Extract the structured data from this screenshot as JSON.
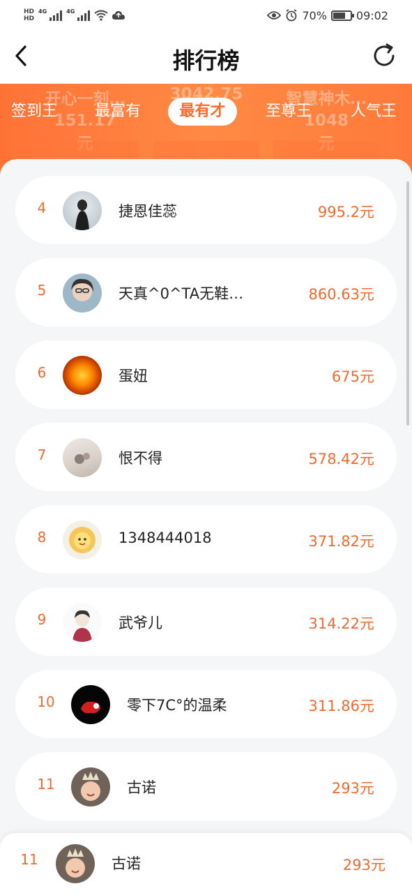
{
  "status": {
    "battery": "70%",
    "time": "09:02",
    "net1": "4G",
    "net2": "4G"
  },
  "nav": {
    "title": "排行榜"
  },
  "tabs": [
    {
      "label": "签到王"
    },
    {
      "label": "最富有"
    },
    {
      "label": "最有才"
    },
    {
      "label": "至尊王"
    },
    {
      "label": "人气王"
    }
  ],
  "podium": [
    {
      "name": "开心一刻…",
      "amount": "151.17",
      "unit": "元"
    },
    {
      "name": "",
      "amount": "3042.75",
      "unit": ""
    },
    {
      "name": "智慧神木…",
      "amount": "1048",
      "unit": "元"
    }
  ],
  "list": [
    {
      "rank": "4",
      "name": "捷恩佳蕊",
      "amount": "995.2元"
    },
    {
      "rank": "5",
      "name": "天真^0^TA无鞋…",
      "amount": "860.63元"
    },
    {
      "rank": "6",
      "name": "蛋妞",
      "amount": "675元"
    },
    {
      "rank": "7",
      "name": "恨不得",
      "amount": "578.42元"
    },
    {
      "rank": "8",
      "name": "1348444018",
      "amount": "371.82元"
    },
    {
      "rank": "9",
      "name": "武爷儿",
      "amount": "314.22元"
    },
    {
      "rank": "10",
      "name": "零下7C°的温柔",
      "amount": "311.86元"
    },
    {
      "rank": "11",
      "name": "古诺",
      "amount": "293元"
    }
  ],
  "my_rank": {
    "rank": "11",
    "name": "古诺",
    "amount": "293元"
  },
  "colors": {
    "accent": "#ef6a2e",
    "band": "#ff7a3a"
  }
}
